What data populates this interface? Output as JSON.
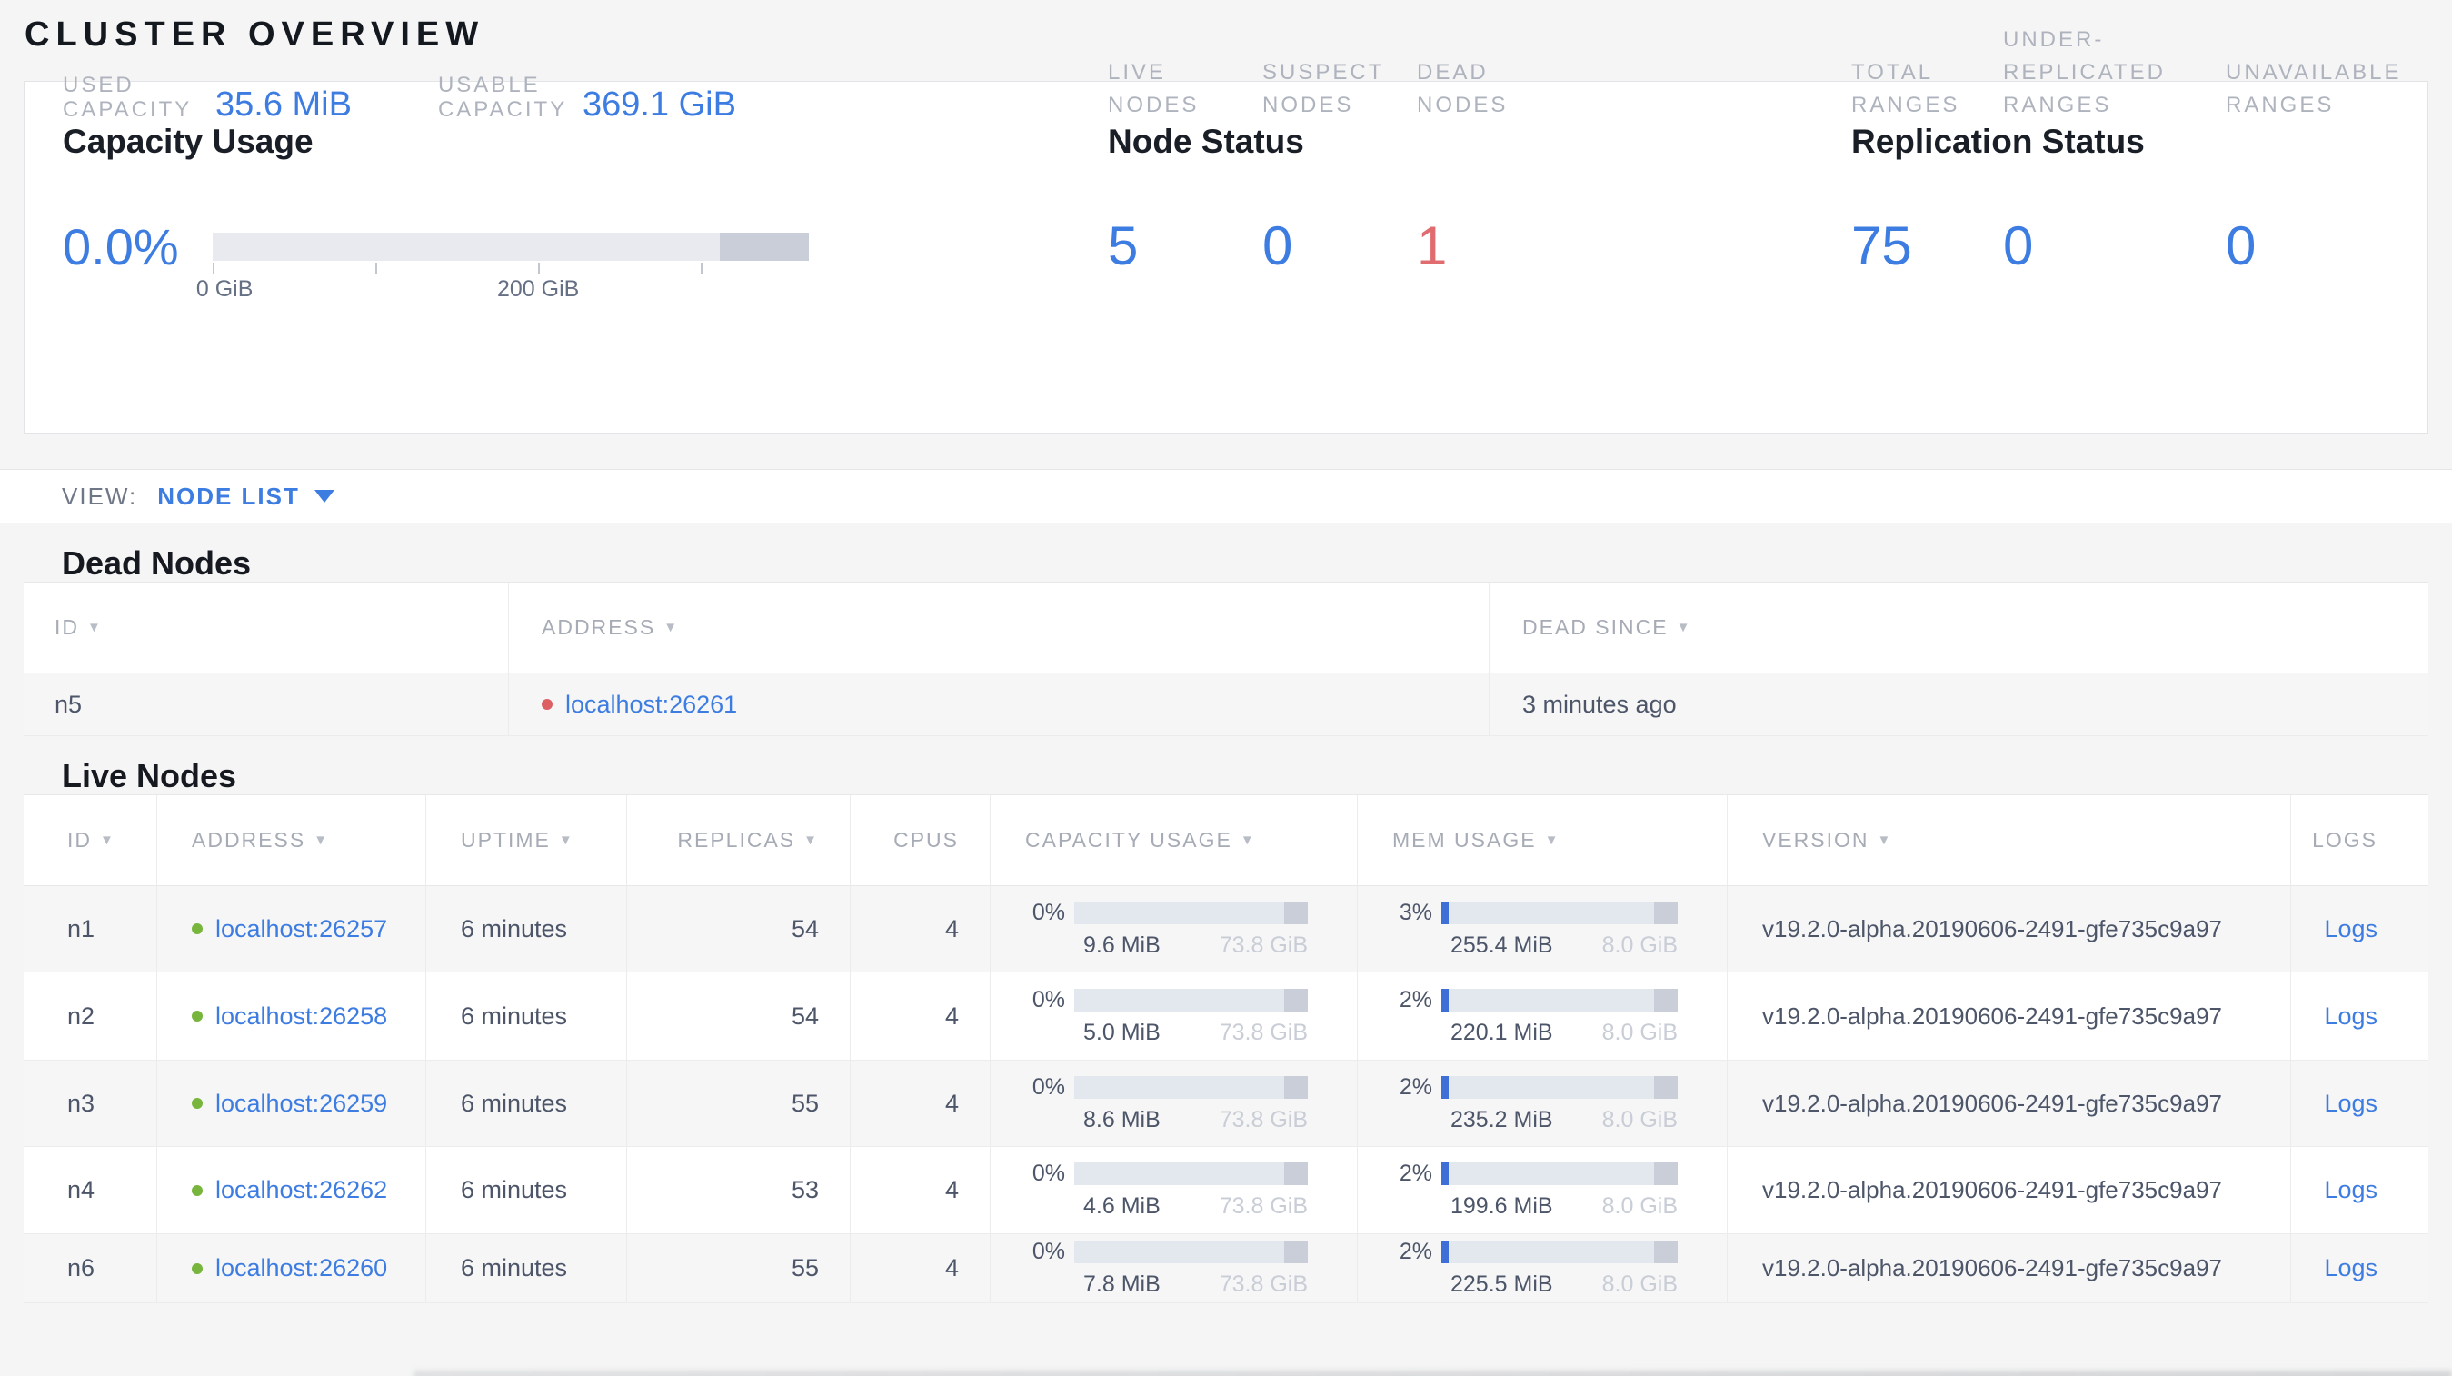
{
  "page": {
    "title": "CLUSTER OVERVIEW"
  },
  "summary": {
    "capacity": {
      "title": "Capacity Usage",
      "percent": "0.0%",
      "gauge_fill_pct": 0,
      "tick_labels": {
        "t0": "0 GiB",
        "t2": "200 GiB"
      },
      "used": {
        "label": "USED CAPACITY",
        "value": "35.6 MiB"
      },
      "usable": {
        "label": "USABLE CAPACITY",
        "value": "369.1 GiB"
      }
    },
    "node_status": {
      "title": "Node Status",
      "live": {
        "value": "5",
        "label": "LIVE NODES"
      },
      "suspect": {
        "value": "0",
        "label": "SUSPECT NODES"
      },
      "dead": {
        "value": "1",
        "label": "DEAD NODES"
      }
    },
    "replication": {
      "title": "Replication Status",
      "total": {
        "value": "75",
        "label": "TOTAL RANGES"
      },
      "under": {
        "value": "0",
        "label": "UNDER-REPLICATED RANGES"
      },
      "unavailable": {
        "value": "0",
        "label": "UNAVAILABLE RANGES"
      }
    }
  },
  "view_bar": {
    "label": "VIEW:",
    "selected": "NODE LIST"
  },
  "dead_nodes": {
    "heading": "Dead Nodes",
    "columns": [
      {
        "label": "ID",
        "arrow": "▼"
      },
      {
        "label": "ADDRESS",
        "arrow": "▼"
      },
      {
        "label": "DEAD SINCE",
        "arrow": "▼"
      }
    ],
    "rows": [
      {
        "id": "n5",
        "address": "localhost:26261",
        "dead_since": "3 minutes ago"
      }
    ]
  },
  "live_nodes": {
    "heading": "Live Nodes",
    "columns": [
      {
        "label": "ID",
        "arrow": "▼"
      },
      {
        "label": "ADDRESS",
        "arrow": "▼"
      },
      {
        "label": "UPTIME",
        "arrow": "▼"
      },
      {
        "label": "REPLICAS",
        "arrow": "▼"
      },
      {
        "label": "CPUS",
        "arrow": ""
      },
      {
        "label": "CAPACITY USAGE",
        "arrow": "▼"
      },
      {
        "label": "MEM USAGE",
        "arrow": "▼"
      },
      {
        "label": "VERSION",
        "arrow": "▼"
      },
      {
        "label": "LOGS",
        "arrow": ""
      }
    ],
    "rows": [
      {
        "id": "n1",
        "address": "localhost:26257",
        "uptime": "6 minutes",
        "replicas": "54",
        "cpus": "4",
        "capacity": {
          "percent": "0%",
          "used": "9.6 MiB",
          "total": "73.8 GiB",
          "fill_pct": 0
        },
        "memory": {
          "percent": "3%",
          "used": "255.4 MiB",
          "total": "8.0 GiB",
          "fill_pct": 3
        },
        "version": "v19.2.0-alpha.20190606-2491-gfe735c9a97",
        "logs": "Logs"
      },
      {
        "id": "n2",
        "address": "localhost:26258",
        "uptime": "6 minutes",
        "replicas": "54",
        "cpus": "4",
        "capacity": {
          "percent": "0%",
          "used": "5.0 MiB",
          "total": "73.8 GiB",
          "fill_pct": 0
        },
        "memory": {
          "percent": "2%",
          "used": "220.1 MiB",
          "total": "8.0 GiB",
          "fill_pct": 2
        },
        "version": "v19.2.0-alpha.20190606-2491-gfe735c9a97",
        "logs": "Logs"
      },
      {
        "id": "n3",
        "address": "localhost:26259",
        "uptime": "6 minutes",
        "replicas": "55",
        "cpus": "4",
        "capacity": {
          "percent": "0%",
          "used": "8.6 MiB",
          "total": "73.8 GiB",
          "fill_pct": 0
        },
        "memory": {
          "percent": "2%",
          "used": "235.2 MiB",
          "total": "8.0 GiB",
          "fill_pct": 2
        },
        "version": "v19.2.0-alpha.20190606-2491-gfe735c9a97",
        "logs": "Logs"
      },
      {
        "id": "n4",
        "address": "localhost:26262",
        "uptime": "6 minutes",
        "replicas": "53",
        "cpus": "4",
        "capacity": {
          "percent": "0%",
          "used": "4.6 MiB",
          "total": "73.8 GiB",
          "fill_pct": 0
        },
        "memory": {
          "percent": "2%",
          "used": "199.6 MiB",
          "total": "8.0 GiB",
          "fill_pct": 2
        },
        "version": "v19.2.0-alpha.20190606-2491-gfe735c9a97",
        "logs": "Logs"
      },
      {
        "id": "n6",
        "address": "localhost:26260",
        "uptime": "6 minutes",
        "replicas": "55",
        "cpus": "4",
        "capacity": {
          "percent": "0%",
          "used": "7.8 MiB",
          "total": "73.8 GiB",
          "fill_pct": 0
        },
        "memory": {
          "percent": "2%",
          "used": "225.5 MiB",
          "total": "8.0 GiB",
          "fill_pct": 2
        },
        "version": "v19.2.0-alpha.20190606-2491-gfe735c9a97",
        "logs": "Logs"
      }
    ]
  },
  "colors": {
    "accent_blue": "#3d7ce1",
    "danger_red": "#e06c70",
    "live_green": "#77b53c",
    "bar_track": "#e3e7ee",
    "bar_other": "#c9ced8",
    "bar_fill": "#3d6fd7"
  }
}
